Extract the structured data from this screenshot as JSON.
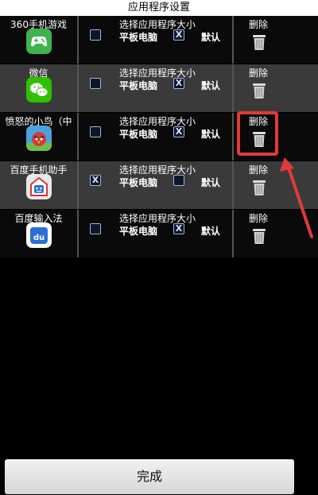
{
  "header": {
    "title": "应用程序设置"
  },
  "apps": [
    {
      "name": "360手机游戏",
      "size_title": "选择应用程序大小",
      "option_tablet": "平板电脑",
      "option_default": "默认",
      "tablet_checked": false,
      "default_checked": true,
      "delete_label": "删除",
      "icon": "game-controller-icon",
      "icon_color": "#3fb34f"
    },
    {
      "name": "微信",
      "size_title": "选择应用程序大小",
      "option_tablet": "平板电脑",
      "option_default": "默认",
      "tablet_checked": false,
      "default_checked": true,
      "delete_label": "删除",
      "icon": "wechat-icon",
      "icon_color": "#2dc100"
    },
    {
      "name": "愤怒的小鸟（中",
      "size_title": "选择应用程序大小",
      "option_tablet": "平板电脑",
      "option_default": "默认",
      "tablet_checked": false,
      "default_checked": true,
      "delete_label": "删除",
      "icon": "angry-birds-icon",
      "icon_color": "#d63a3a"
    },
    {
      "name": "百度手机助手",
      "size_title": "选择应用程序大小",
      "option_tablet": "平板电脑",
      "option_default": "默认",
      "tablet_checked": true,
      "default_checked": false,
      "delete_label": "删除",
      "icon": "baidu-assistant-icon",
      "icon_color": "#e8e8e8"
    },
    {
      "name": "百度输入法",
      "size_title": "选择应用程序大小",
      "option_tablet": "平板电脑",
      "option_default": "默认",
      "tablet_checked": false,
      "default_checked": true,
      "delete_label": "删除",
      "icon": "baidu-input-icon",
      "icon_color": "#2a6fd6"
    }
  ],
  "checkbox_mark": "X",
  "footer": {
    "done_label": "完成"
  },
  "annotation": {
    "color": "#e23a3a"
  }
}
